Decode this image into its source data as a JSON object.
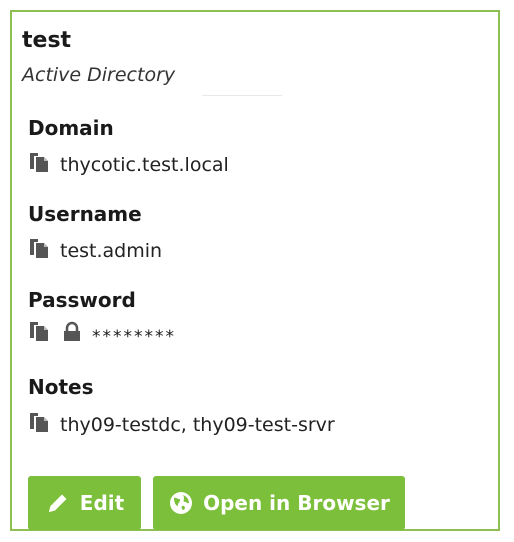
{
  "card": {
    "title": "test",
    "subtitle": "Active Directory"
  },
  "fields": [
    {
      "label": "Domain",
      "value": "thycotic.test.local"
    },
    {
      "label": "Username",
      "value": "test.admin"
    },
    {
      "label": "Password",
      "value": "********"
    },
    {
      "label": "Notes",
      "value": "thy09-testdc, thy09-test-srvr"
    }
  ],
  "buttons": {
    "edit_label": "Edit",
    "open_label": "Open in Browser"
  },
  "icons": {
    "copy": "copy-icon",
    "lock": "lock-icon",
    "edit": "pencil-icon",
    "browser": "globe-icon"
  },
  "colors": {
    "border": "#8dbf53",
    "button": "#7cbf3a"
  }
}
